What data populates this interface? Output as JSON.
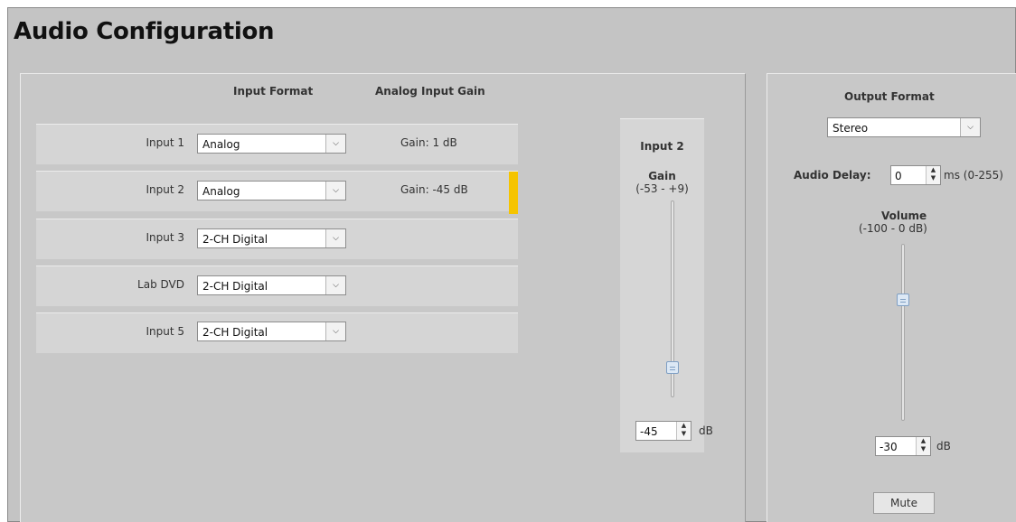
{
  "title": "Audio Configuration",
  "columns": {
    "input_format": "Input Format",
    "analog_gain": "Analog Input Gain"
  },
  "inputs": [
    {
      "label": "Input 1",
      "format": "Analog",
      "gain": "Gain: 1 dB"
    },
    {
      "label": "Input 2",
      "format": "Analog",
      "gain": "Gain: -45 dB"
    },
    {
      "label": "Input 3",
      "format": "2-CH Digital",
      "gain": ""
    },
    {
      "label": "Lab DVD",
      "format": "2-CH Digital",
      "gain": ""
    },
    {
      "label": "Input 5",
      "format": "2-CH Digital",
      "gain": ""
    }
  ],
  "selected_input_index": 1,
  "gain_panel": {
    "title": "Input 2",
    "gain_label": "Gain",
    "range": "(-53 - +9)",
    "value": "-45",
    "unit": "dB",
    "slider_min": -53,
    "slider_max": 9,
    "slider_value": -45
  },
  "output": {
    "heading": "Output Format",
    "format": "Stereo",
    "delay_label": "Audio Delay:",
    "delay_value": "0",
    "delay_range": "ms (0-255)",
    "volume_label": "Volume",
    "volume_range": "(-100 - 0 dB)",
    "volume_value": "-30",
    "volume_unit": "dB",
    "volume_min": -100,
    "volume_max": 0,
    "volume_slider_value": -30,
    "mute_label": "Mute"
  },
  "colors": {
    "highlight": "#f5c400",
    "panel": "#c8c8c8",
    "row": "#d5d5d5"
  }
}
